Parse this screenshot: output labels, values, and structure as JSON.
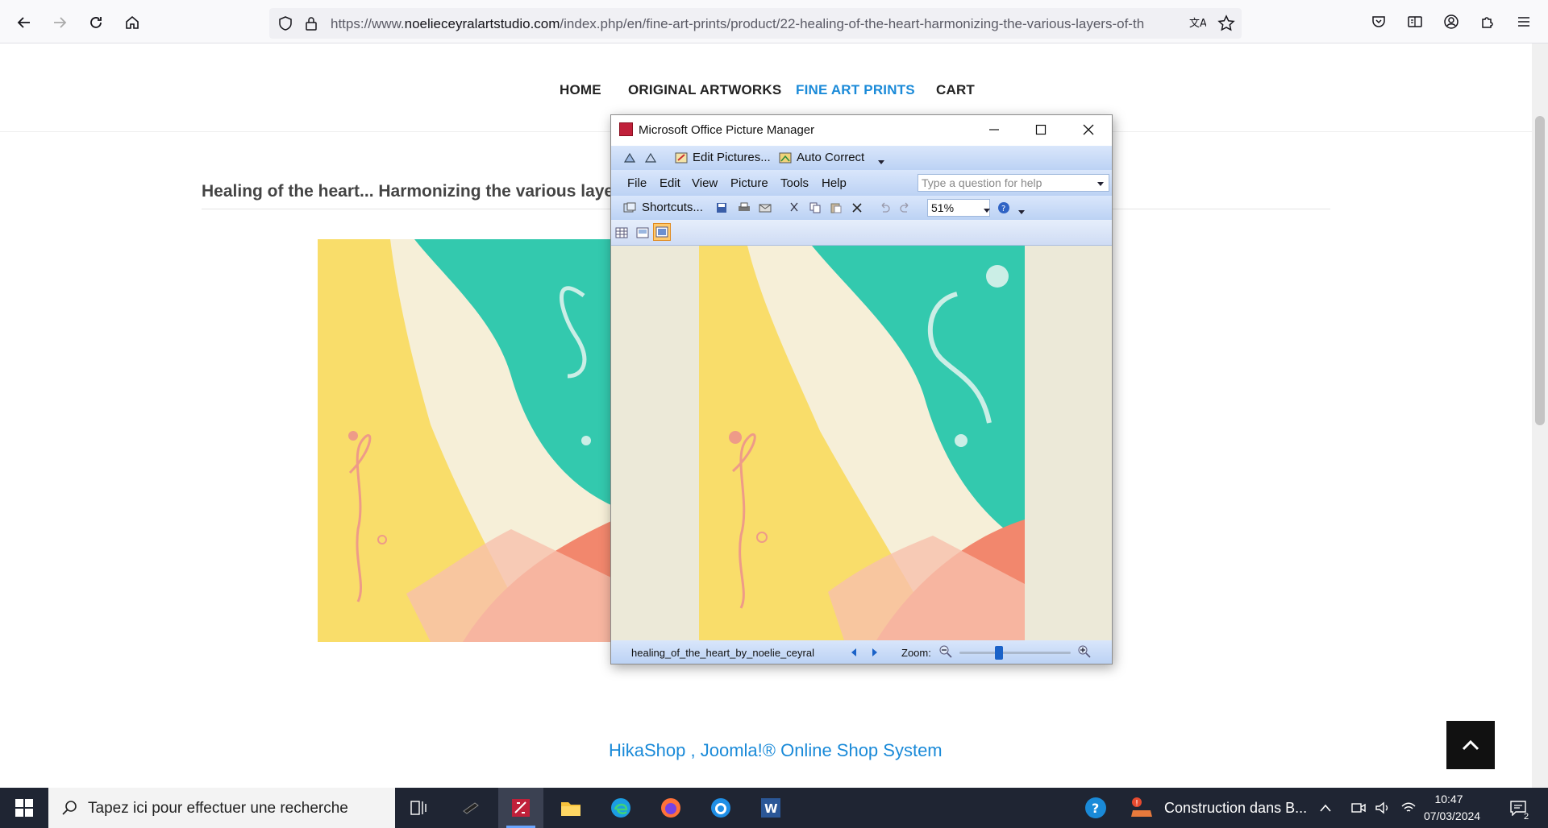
{
  "browser": {
    "url_prefix": "https://www.",
    "url_host": "noelieceyralartstudio.com",
    "url_path": "/index.php/en/fine-art-prints/product/22-healing-of-the-heart-harmonizing-the-various-layers-of-th"
  },
  "site": {
    "nav": [
      "HOME",
      "ORIGINAL ARTWORKS",
      "FINE ART PRINTS",
      "CART"
    ],
    "product_title": "Healing of the heart... Harmonizing the various layers",
    "footer_link": "HikaShop , Joomla!® Online Shop System"
  },
  "picture_manager": {
    "title": "Microsoft Office Picture Manager",
    "toolbar1": {
      "edit_pictures": "Edit Pictures...",
      "auto_correct": "Auto Correct"
    },
    "menu": [
      "File",
      "Edit",
      "View",
      "Picture",
      "Tools",
      "Help"
    ],
    "help_placeholder": "Type a question for help",
    "toolbar2": {
      "shortcuts": "Shortcuts...",
      "zoom_value": "51%"
    },
    "status": {
      "filename": "healing_of_the_heart_by_noelie_ceyral",
      "zoom_label": "Zoom:",
      "zoom_level": 0.34
    }
  },
  "taskbar": {
    "search_placeholder": "Tapez ici pour effectuer une recherche",
    "notification": "Construction dans B...",
    "time": "10:47",
    "date": "07/03/2024",
    "badge": "2"
  },
  "colors": {
    "accent_blue": "#1a8ad8",
    "taskbar": "#1f2533",
    "painting_teal": "#33c9ae",
    "painting_yellow": "#f9dd6a",
    "painting_coral": "#f2876d"
  }
}
